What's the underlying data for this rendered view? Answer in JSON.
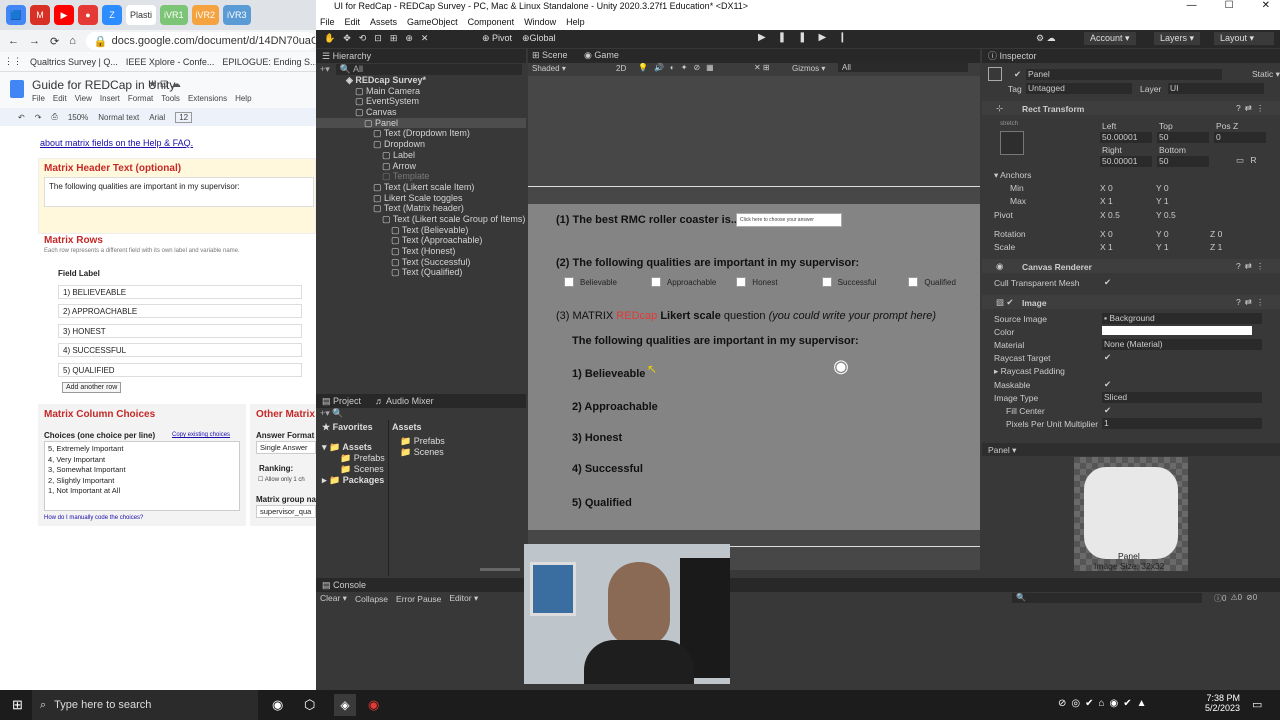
{
  "chrome": {
    "tabs": [
      "🟦",
      "M",
      "▶",
      "●",
      "Z",
      "Plasti",
      "iVR1",
      "iVR2",
      "iVR3"
    ],
    "url": "docs.google.com/document/d/14DN70uaClhVcI",
    "bookmarks": [
      "Qualtrics Survey | Q...",
      "IEEE Xplore - Confe...",
      "EPILOGUE: Ending S..."
    ]
  },
  "doc": {
    "title": "Guide for REDCap in Unity",
    "menu": [
      "File",
      "Edit",
      "View",
      "Insert",
      "Format",
      "Tools",
      "Extensions",
      "Help"
    ],
    "toolbar": {
      "zoom": "150%",
      "style": "Normal text",
      "font": "Arial",
      "size": "12"
    },
    "link_text": "about matrix fields on the Help & FAQ.",
    "header_label": "Matrix Header Text (optional)",
    "header_value": "The following qualities are important in my supervisor:",
    "rows_label": "Matrix Rows",
    "rows_note": "Each row represents a different field with its own label and variable name.",
    "field_label": "Field Label",
    "rows": [
      "1) BELIEVEABLE",
      "2) APPROACHABLE",
      "3) HONEST",
      "4) SUCCESSFUL",
      "5) QUALIFIED"
    ],
    "add_row": "Add another row",
    "choices_label": "Matrix Column Choices",
    "choices_sub": "Choices (one choice per line)",
    "copy_choices": "Copy existing choices",
    "choices": [
      "5, Extremely Important",
      "4, Very Important",
      "3, Somewhat Important",
      "2, Slightly Important",
      "1, Not Important at All"
    ],
    "manual_code": "How do I manually code the choices?",
    "other_label": "Other Matrix",
    "answer_format": "Answer Format",
    "single_answer": "Single Answer",
    "ranking": "Ranking:",
    "allow_only": "Allow only 1 ch",
    "group_name": "Matrix group na",
    "group_value": "supervisor_qua"
  },
  "unity": {
    "title": "UI for RedCap - REDCap Survey - PC, Mac & Linux Standalone - Unity 2020.3.27f1 Education* <DX11>",
    "menu": [
      "File",
      "Edit",
      "Assets",
      "GameObject",
      "Component",
      "Window",
      "Help"
    ],
    "toolbar": {
      "pivot": "Pivot",
      "global": "Global",
      "account": "Account",
      "layers": "Layers",
      "layout": "Layout"
    },
    "hierarchy_title": "Hierarchy",
    "hierarchy_search": "All",
    "hierarchy": [
      {
        "label": "REDcap Survey*",
        "indent": 0,
        "bold": true
      },
      {
        "label": "Main Camera",
        "indent": 1
      },
      {
        "label": "EventSystem",
        "indent": 1
      },
      {
        "label": "Canvas",
        "indent": 1
      },
      {
        "label": "Panel",
        "indent": 2,
        "selected": true
      },
      {
        "label": "Text (Dropdown Item)",
        "indent": 3
      },
      {
        "label": "Dropdown",
        "indent": 3
      },
      {
        "label": "Label",
        "indent": 4
      },
      {
        "label": "Arrow",
        "indent": 4
      },
      {
        "label": "Template",
        "indent": 4,
        "dim": true
      },
      {
        "label": "Text (Likert scale Item)",
        "indent": 3
      },
      {
        "label": "Likert Scale toggles",
        "indent": 3
      },
      {
        "label": "Text (Matrix header)",
        "indent": 3
      },
      {
        "label": "Text (Likert scale Group of Items)",
        "indent": 4
      },
      {
        "label": "Text (Believable)",
        "indent": 5
      },
      {
        "label": "Text (Approachable)",
        "indent": 5
      },
      {
        "label": "Text (Honest)",
        "indent": 5
      },
      {
        "label": "Text (Successful)",
        "indent": 5
      },
      {
        "label": "Text (Qualified)",
        "indent": 5
      }
    ],
    "scene_tab": "Scene",
    "game_tab": "Game",
    "shaded": "Shaded",
    "two_d": "2D",
    "gizmos": "Gizmos",
    "scene_search": "All",
    "project_tab": "Project",
    "audio_tab": "Audio Mixer",
    "favorites": "Favorites",
    "assets": "Assets",
    "prefabs": "Prefabs",
    "scenes": "Scenes",
    "packages": "Packages",
    "assets_header": "Assets",
    "console": "Console",
    "console_btns": [
      "Clear",
      "Collapse",
      "Error Pause",
      "Editor"
    ],
    "console_counts": [
      "0",
      "0",
      "0"
    ]
  },
  "survey": {
    "q1": "(1) The best RMC roller coaster is...",
    "dropdown": "Click here to choose your answer",
    "q2": "(2) The following qualities are important in my supervisor:",
    "options": [
      "Believable",
      "Approachable",
      "Honest",
      "Successful",
      "Qualified"
    ],
    "q3_prefix": "(3) MATRIX ",
    "q3_brand": "REDcap",
    "q3_bold": " Likert scale",
    "q3_plain": " question ",
    "q3_italic": "(you could write your prompt here)",
    "matrix_header": "The following qualities are important in my supervisor:",
    "items": [
      "1) Believeable",
      "2) Approachable",
      "3) Honest",
      "4) Successful",
      "5) Qualified"
    ],
    "brand_color": "#e53935"
  },
  "inspector": {
    "title": "Inspector",
    "object": "Panel",
    "static": "Static",
    "tag_label": "Tag",
    "tag": "Untagged",
    "layer_label": "Layer",
    "layer": "UI",
    "rect": "Rect Transform",
    "stretch": "stretch",
    "left_label": "Left",
    "left": "50.00001",
    "top_label": "Top",
    "top": "50",
    "posz_label": "Pos Z",
    "posz": "0",
    "right_label": "Right",
    "right": "50.00001",
    "bottom_label": "Bottom",
    "bottom": "50",
    "anchors": "Anchors",
    "min": "Min",
    "min_x": "0",
    "min_y": "0",
    "max": "Max",
    "max_x": "1",
    "max_y": "1",
    "pivot": "Pivot",
    "pivot_x": "0.5",
    "pivot_y": "0.5",
    "rotation": "Rotation",
    "rot_x": "0",
    "rot_y": "0",
    "rot_z": "0",
    "scale": "Scale",
    "sc_x": "1",
    "sc_y": "1",
    "sc_z": "1",
    "canvas_renderer": "Canvas Renderer",
    "cull": "Cull Transparent Mesh",
    "image": "Image",
    "source_image": "Source Image",
    "source_value": "Background",
    "color": "Color",
    "material": "Material",
    "material_value": "None (Material)",
    "raycast": "Raycast Target",
    "raycast_padding": "Raycast Padding",
    "maskable": "Maskable",
    "image_type": "Image Type",
    "image_type_value": "Sliced",
    "fill_center": "Fill Center",
    "ppu": "Pixels Per Unit Multiplier",
    "ppu_value": "1",
    "preview_title": "Panel",
    "preview_name": "Panel",
    "preview_size": "Image Size: 32x32"
  },
  "taskbar": {
    "search": "Type here to search",
    "time": "7:38 PM",
    "date": "5/2/2023"
  }
}
